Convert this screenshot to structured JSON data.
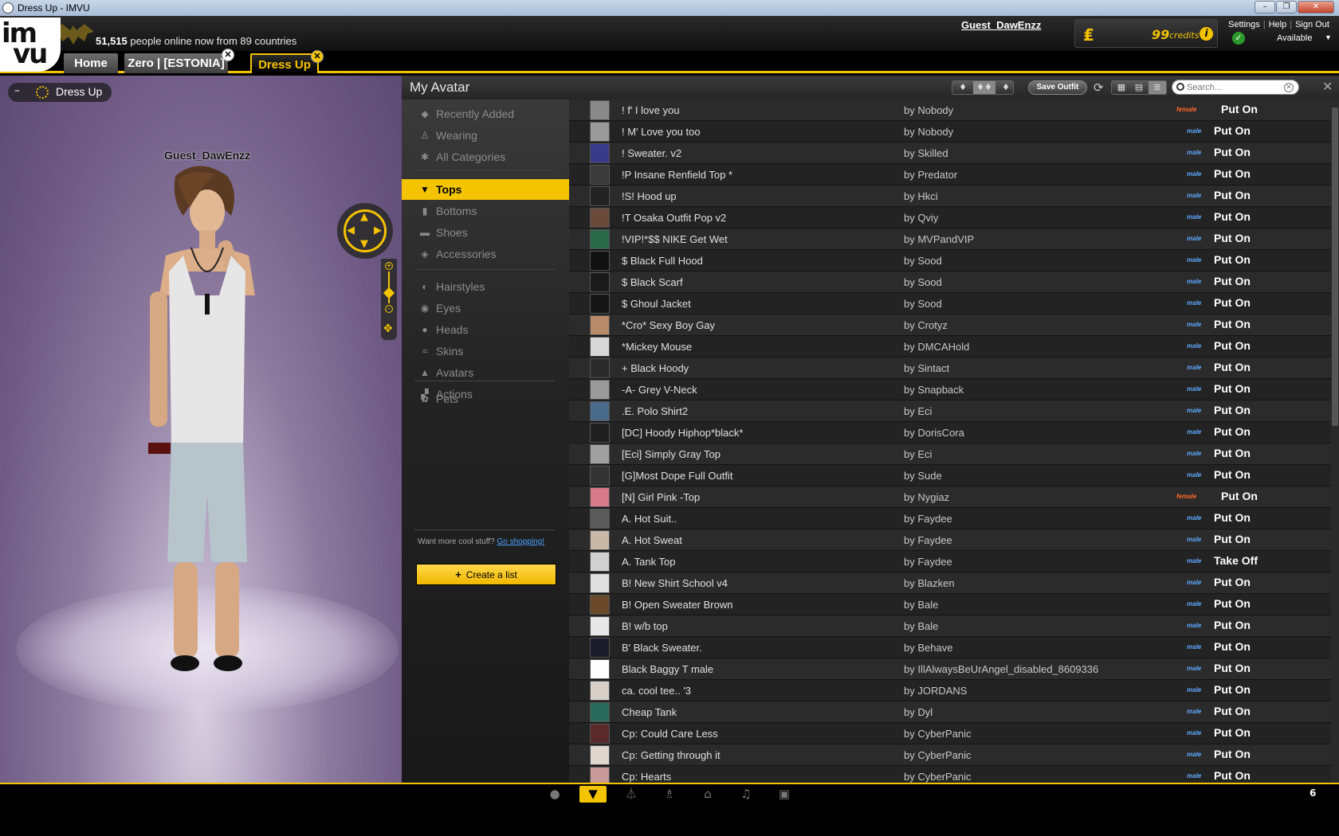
{
  "window": {
    "title": "Dress Up - IMVU"
  },
  "header": {
    "online_count": "51,515",
    "online_text": "people online now from 89 countries",
    "username": "Guest_DawEnzz",
    "credits_value": "99",
    "credits_label": "credits",
    "links": {
      "settings": "Settings",
      "help": "Help",
      "signout": "Sign Out"
    },
    "status": "Available"
  },
  "tabs": [
    {
      "label": "Home"
    },
    {
      "label": "Zero | [ESTONIA]"
    },
    {
      "label": "Dress Up"
    }
  ],
  "avatar_panel": {
    "pill_label": "Dress Up",
    "avatar_name": "Guest_DawEnzz"
  },
  "panel": {
    "title": "My Avatar",
    "save_outfit": "Save Outfit",
    "search_placeholder": "Search..."
  },
  "sidebar": {
    "groups": [
      [
        {
          "label": "Recently Added",
          "icon": "tag-icon"
        },
        {
          "label": "Wearing",
          "icon": "person-icon"
        },
        {
          "label": "All Categories",
          "icon": "asterisk-icon"
        }
      ],
      [
        {
          "label": "Tops",
          "icon": "shirt-icon",
          "active": true
        },
        {
          "label": "Bottoms",
          "icon": "pants-icon"
        },
        {
          "label": "Shoes",
          "icon": "shoe-icon"
        },
        {
          "label": "Accessories",
          "icon": "diamond-icon"
        }
      ],
      [
        {
          "label": "Hairstyles",
          "icon": "hair-icon"
        },
        {
          "label": "Eyes",
          "icon": "eye-icon"
        },
        {
          "label": "Heads",
          "icon": "head-icon"
        },
        {
          "label": "Skins",
          "icon": "skin-icon"
        },
        {
          "label": "Avatars",
          "icon": "avatar-icon"
        },
        {
          "label": "Actions",
          "icon": "actions-icon"
        }
      ],
      [
        {
          "label": "Pets",
          "icon": "paw-icon"
        }
      ]
    ],
    "more_text": "Want more cool stuff?",
    "shop_link": "Go shopping!",
    "create_list": "Create a list",
    "create_plus": "+"
  },
  "items": [
    {
      "name": "! f' I love you",
      "creator": "by Nobody",
      "gender": "female",
      "action": "Put On",
      "thumb": "#8a8a8a"
    },
    {
      "name": "! M' Love you too",
      "creator": "by Nobody",
      "gender": "male",
      "action": "Put On",
      "thumb": "#9a9a9a"
    },
    {
      "name": "! Sweater. v2",
      "creator": "by Skilled",
      "gender": "male",
      "action": "Put On",
      "thumb": "#3a3a8a"
    },
    {
      "name": "!P Insane Renfield Top *",
      "creator": "by Predator",
      "gender": "male",
      "action": "Put On",
      "thumb": "#3a3a3a"
    },
    {
      "name": "!S! Hood up",
      "creator": "by Hkci",
      "gender": "male",
      "action": "Put On",
      "thumb": "#222222"
    },
    {
      "name": "!T Osaka Outfit Pop v2",
      "creator": "by Qviy",
      "gender": "male",
      "action": "Put On",
      "thumb": "#6a4a3a"
    },
    {
      "name": "!VIP!*$$ NIKE Get Wet",
      "creator": "by MVPandVIP",
      "gender": "male",
      "action": "Put On",
      "thumb": "#2a6a4a"
    },
    {
      "name": "$ Black Full Hood",
      "creator": "by Sood",
      "gender": "male",
      "action": "Put On",
      "thumb": "#111111"
    },
    {
      "name": "$ Black Scarf",
      "creator": "by Sood",
      "gender": "male",
      "action": "Put On",
      "thumb": "#1a1a1a"
    },
    {
      "name": "$ Ghoul Jacket",
      "creator": "by Sood",
      "gender": "male",
      "action": "Put On",
      "thumb": "#151515"
    },
    {
      "name": "*Cro* Sexy Boy Gay",
      "creator": "by Crotyz",
      "gender": "male",
      "action": "Put On",
      "thumb": "#b88a6a"
    },
    {
      "name": "*Mickey Mouse",
      "creator": "by DMCAHold",
      "gender": "male",
      "action": "Put On",
      "thumb": "#d8d8d8"
    },
    {
      "name": "+ Black Hoody",
      "creator": "by Sintact",
      "gender": "male",
      "action": "Put On",
      "thumb": "#2a2a2a"
    },
    {
      "name": "-A- Grey V-Neck",
      "creator": "by Snapback",
      "gender": "male",
      "action": "Put On",
      "thumb": "#9a9a9a"
    },
    {
      "name": ".E. Polo Shirt2",
      "creator": "by Eci",
      "gender": "male",
      "action": "Put On",
      "thumb": "#4a6a8a"
    },
    {
      "name": "[DC] Hoody Hiphop*black*",
      "creator": "by DorisCora",
      "gender": "male",
      "action": "Put On",
      "thumb": "#1f1f1f"
    },
    {
      "name": "[Eci] Simply Gray Top",
      "creator": "by Eci",
      "gender": "male",
      "action": "Put On",
      "thumb": "#a0a0a0"
    },
    {
      "name": "[G]Most Dope Full Outfit",
      "creator": "by Sude",
      "gender": "male",
      "action": "Put On",
      "thumb": "#333333"
    },
    {
      "name": "[N] Girl Pink -Top",
      "creator": "by Nygiaz",
      "gender": "female",
      "action": "Put On",
      "thumb": "#d87a8a"
    },
    {
      "name": "A. Hot Suit..",
      "creator": "by Faydee",
      "gender": "male",
      "action": "Put On",
      "thumb": "#5a5a5a"
    },
    {
      "name": "A. Hot Sweat",
      "creator": "by Faydee",
      "gender": "male",
      "action": "Put On",
      "thumb": "#c8b8a8"
    },
    {
      "name": "A. Tank Top",
      "creator": "by Faydee",
      "gender": "male",
      "action": "Take Off",
      "thumb": "#d0d0d0"
    },
    {
      "name": "B! New Shirt School v4",
      "creator": "by Blazken",
      "gender": "male",
      "action": "Put On",
      "thumb": "#e0e0e0"
    },
    {
      "name": "B! Open Sweater Brown",
      "creator": "by Bale",
      "gender": "male",
      "action": "Put On",
      "thumb": "#6a4a2a"
    },
    {
      "name": "B! w/b top",
      "creator": "by Bale",
      "gender": "male",
      "action": "Put On",
      "thumb": "#e8e8e8"
    },
    {
      "name": "B' Black Sweater.",
      "creator": "by Behave",
      "gender": "male",
      "action": "Put On",
      "thumb": "#1a1a2a"
    },
    {
      "name": "Black Baggy T male",
      "creator": "by IllAlwaysBeUrAngel_disabled_8609336",
      "gender": "male",
      "action": "Put On",
      "thumb": "#ffffff"
    },
    {
      "name": "ca. cool tee.. '3",
      "creator": "by JORDANS",
      "gender": "male",
      "action": "Put On",
      "thumb": "#d8d0c8"
    },
    {
      "name": "Cheap Tank",
      "creator": "by Dyl",
      "gender": "male",
      "action": "Put On",
      "thumb": "#2a6a5a"
    },
    {
      "name": "Cp: Could Care Less",
      "creator": "by CyberPanic",
      "gender": "male",
      "action": "Put On",
      "thumb": "#5a2a2a"
    },
    {
      "name": "Cp: Getting through it",
      "creator": "by CyberPanic",
      "gender": "male",
      "action": "Put On",
      "thumb": "#e0d8d0"
    },
    {
      "name": "Cp: Hearts",
      "creator": "by CyberPanic",
      "gender": "male",
      "action": "Put On",
      "thumb": "#c89a9a"
    }
  ],
  "dock": {
    "icons": [
      "chat-icon",
      "shirt-icon",
      "hanger-icon",
      "chair-icon",
      "home-icon",
      "music-icon",
      "camera-icon"
    ],
    "count": "6"
  },
  "colors": {
    "accent": "#f5c400",
    "male": "#5fa8ff",
    "female": "#ff6a2a"
  }
}
